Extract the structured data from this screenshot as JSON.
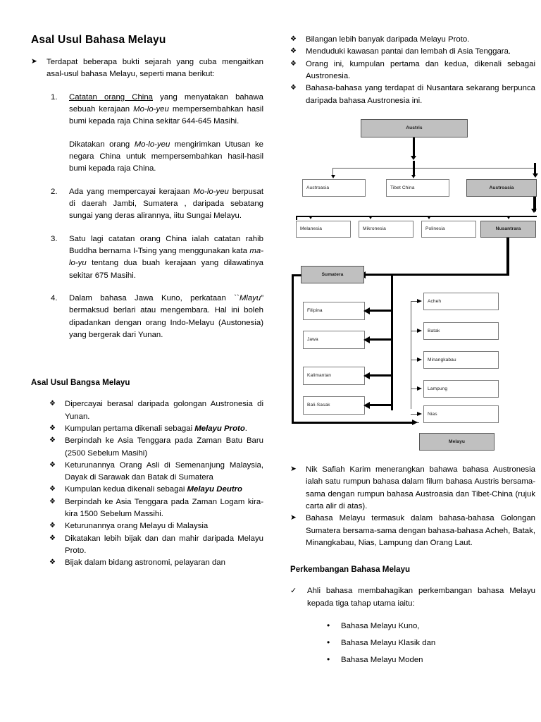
{
  "document": {
    "title": "Asal Usul Bahasa Melayu"
  },
  "left_column": {
    "intro": {
      "bullet": "➤",
      "text": "Terdapat beberapa bukti sejarah yang cuba mengaitkan asal-usul bahasa Melayu, seperti mana berikut:"
    },
    "numbered_items": [
      {
        "number": "1.",
        "part_underline": "Catatan orang China",
        "part_a": " yang menyatakan bahawa sebuah kerajaan ",
        "part_italic": "Mo-lo-yeu",
        "part_b": " mempersembahkan hasil bumi kepada raja China sekitar 644-645 Masihi."
      },
      {
        "number": "",
        "part_a": "Dikatakan orang ",
        "part_italic": "Mo-lo-yeu",
        "part_b": " mengirimkan Utusan ke negara China untuk mempersembahkan hasil-hasil bumi kepada raja China."
      },
      {
        "number": "2.",
        "part_a": "Ada yang mempercayai kerajaan ",
        "part_italic": "Mo-lo-yeu",
        "part_b": " berpusat di daerah Jambi, Sumatera , daripada sebatang sungai yang deras alirannya, iitu Sungai Melayu."
      },
      {
        "number": "3.",
        "part_a": "Satu lagi catatan orang China ialah catatan rahib Buddha bernama I-Tsing yang menggunakan kata ",
        "part_italic": "ma-lo-yu",
        "part_b": " tentang dua buah kerajaan yang dilawatinya sekitar 675 Masihi."
      },
      {
        "number": "4.",
        "part_a": "Dalam bahasa Jawa Kuno, perkataan ``",
        "part_italic": "Mlayu",
        "part_b": "” bermaksud berlari atau mengembara. Hal ini boleh dipadankan dengan orang Indo-Melayu (Austonesia) yang bergerak dari Yunan."
      }
    ],
    "section_bangsa": {
      "heading": "Asal Usul Bangsa Melayu",
      "bullet": "❖",
      "items": [
        {
          "text": "Dipercayai berasal daripada golongan Austronesia di Yunan."
        },
        {
          "pre": "Kumpulan pertama dikenali sebagai ",
          "strong": "Melayu Proto",
          "post": "."
        },
        {
          "text": "Berpindah ke Asia Tenggara pada Zaman Batu Baru (2500 Sebelum Masihi)"
        },
        {
          "text": "Keturunannya Orang Asli di Semenanjung Malaysia, Dayak di Sarawak dan Batak di Sumatera"
        },
        {
          "pre": "Kumpulan kedua dikenali sebagai ",
          "strong": "Melayu Deutro",
          "post": ""
        },
        {
          "text": "Berpindah ke Asia Tenggara pada Zaman Logam kira-kira 1500 Sebelum Massihi."
        },
        {
          "text": "Keturunannya orang Melayu di Malaysia"
        },
        {
          "text": "Dikatakan lebih bijak dan dan mahir daripada Melayu Proto."
        },
        {
          "text": "Bijak dalam bidang astronomi, pelayaran dan"
        }
      ]
    }
  },
  "right_column": {
    "top_items": {
      "bullet": "❖",
      "items": [
        "Bilangan lebih banyak daripada Melayu Proto.",
        "Menduduki kawasan pantai dan lembah di Asia Tenggara.",
        "Orang ini, kumpulan pertama dan kedua, dikenali sebagai Austronesia.",
        "Bahasa-bahasa yang terdapat di Nusantara sekarang berpunca daripada bahasa Austronesia ini."
      ]
    },
    "mid_items": {
      "bullet": "➤",
      "items": [
        "Nik Safiah Karim menerangkan bahawa bahasa Austronesia ialah satu rumpun bahasa dalam filum bahasa Austris bersama-sama dengan rumpun bahasa Austroasia dan Tibet-China (rujuk carta alir di atas).",
        "Bahasa Melayu termasuk dalam bahasa-bahasa Golongan Sumatera bersama-sama dengan bahasa-bahasa Acheh, Batak, Minangkabau, Nias, Lampung dan Orang Laut."
      ]
    },
    "section_perkembangan": {
      "heading": "Perkembangan Bahasa Melayu",
      "check_bullet": "✓",
      "check_text": "Ahli bahasa membahagikan perkembangan bahasa Melayu kepada tiga tahap utama iaitu:",
      "dot_bullet": "•",
      "stages": [
        "Bahasa Melayu Kuno,",
        "Bahasa Melayu Klasik dan",
        "Bahasa Melayu Moden"
      ]
    }
  },
  "chart_data": {
    "type": "diagram",
    "title": "Carta alir rumpun bahasa Austris",
    "shaded_color": "#c0c0c0",
    "nodes": {
      "root": "Austris",
      "level1": [
        "Austroasia",
        "Tibet China",
        "Austroasia"
      ],
      "level2": [
        "Melanesia",
        "Mikronesia",
        "Polinesia",
        "Nusantrara"
      ],
      "group_head": "Sumatera",
      "left_branch": [
        "Filipina",
        "Jawa",
        "Kalimantan",
        "Bali-Sasak"
      ],
      "right_branch": [
        "Acheh",
        "Batak",
        "Minangkabau",
        "Lampung",
        "Nias"
      ],
      "terminal": "Melayu"
    },
    "shaded_nodes": [
      "Austris",
      "Austroasia",
      "Nusantrara",
      "Sumatera",
      "Melayu"
    ]
  }
}
